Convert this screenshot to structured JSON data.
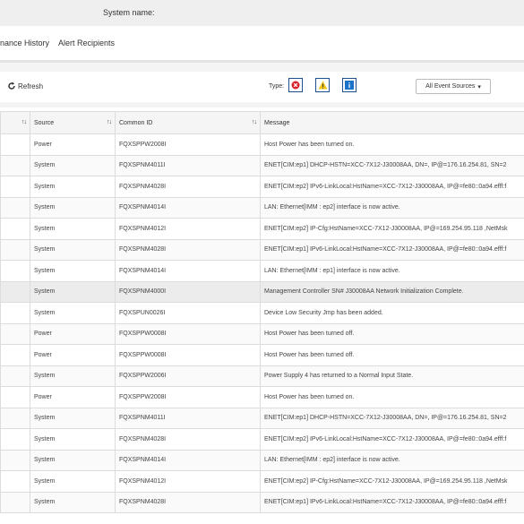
{
  "header": {
    "system_name_label": "System name:"
  },
  "tabs": [
    {
      "label": "nance History"
    },
    {
      "label": "Alert Recipients"
    }
  ],
  "toolbar": {
    "refresh_label": "Refresh",
    "type_label": "Type:",
    "filter_dropdown_label": "All Event Sources",
    "type_buttons": [
      {
        "icon": "error-icon",
        "color": "#d9232d"
      },
      {
        "icon": "warning-icon",
        "color": "#f0c419"
      },
      {
        "icon": "info-icon",
        "color": "#1a73c8"
      }
    ]
  },
  "table": {
    "headers": [
      "Source",
      "Common ID",
      "Message"
    ],
    "rows": [
      {
        "source": "Power",
        "id": "FQXSPPW2008I",
        "message": "Host Power has been turned on."
      },
      {
        "source": "System",
        "id": "FQXSPNM4011I",
        "message": "ENET[CIM:ep1] DHCP-HSTN=XCC-7X12-J30008AA, DN=, IP@=176.16.254.81, SN=2"
      },
      {
        "source": "System",
        "id": "FQXSPNM4028I",
        "message": "ENET[CIM:ep2] IPv6-LinkLocal:HstName=XCC-7X12-J30008AA, IP@=fe80::0a94.efff:f"
      },
      {
        "source": "System",
        "id": "FQXSPNM4014I",
        "message": "LAN: Ethernet[IMM : ep2] interface is now active."
      },
      {
        "source": "System",
        "id": "FQXSPNM4012I",
        "message": "ENET[CIM:ep2] IP-Cfg:HstName=XCC-7X12-J30008AA, IP@=169.254.95.118 ,NetMsk"
      },
      {
        "source": "System",
        "id": "FQXSPNM4028I",
        "message": "ENET[CIM:ep1] IPv6-LinkLocal:HstName=XCC-7X12-J30008AA, IP@=fe80::0a94.efff:f"
      },
      {
        "source": "System",
        "id": "FQXSPNM4014I",
        "message": "LAN: Ethernet[IMM : ep1] interface is now active."
      },
      {
        "source": "System",
        "id": "FQXSPNM4000I",
        "message": "Management Controller SN# J30008AA Network Initialization Complete."
      },
      {
        "source": "System",
        "id": "FQXSPUN0026I",
        "message": "Device Low Security Jmp has been added."
      },
      {
        "source": "Power",
        "id": "FQXSPPW0008I",
        "message": "Host Power has been turned off."
      },
      {
        "source": "Power",
        "id": "FQXSPPW0008I",
        "message": "Host Power has been turned off."
      },
      {
        "source": "System",
        "id": "FQXSPPW2006I",
        "message": "Power Supply 4 has returned to a Normal Input State."
      },
      {
        "source": "Power",
        "id": "FQXSPPW2008I",
        "message": "Host Power has been turned on."
      },
      {
        "source": "System",
        "id": "FQXSPNM4011I",
        "message": "ENET[CIM:ep1] DHCP-HSTN=XCC-7X12-J30008AA, DN=, IP@=176.16.254.81, SN=2"
      },
      {
        "source": "System",
        "id": "FQXSPNM4028I",
        "message": "ENET[CIM:ep2] IPv6-LinkLocal:HstName=XCC-7X12-J30008AA, IP@=fe80::0a94.efff:f"
      },
      {
        "source": "System",
        "id": "FQXSPNM4014I",
        "message": "LAN: Ethernet[IMM : ep2] interface is now active."
      },
      {
        "source": "System",
        "id": "FQXSPNM4012I",
        "message": "ENET[CIM:ep2] IP-Cfg:HstName=XCC-7X12-J30008AA, IP@=169.254.95.118 ,NetMsk"
      },
      {
        "source": "System",
        "id": "FQXSPNM4028I",
        "message": "ENET[CIM:ep1] IPv6-LinkLocal:HstName=XCC-7X12-J30008AA, IP@=fe80::0a94.efff:f"
      }
    ]
  }
}
